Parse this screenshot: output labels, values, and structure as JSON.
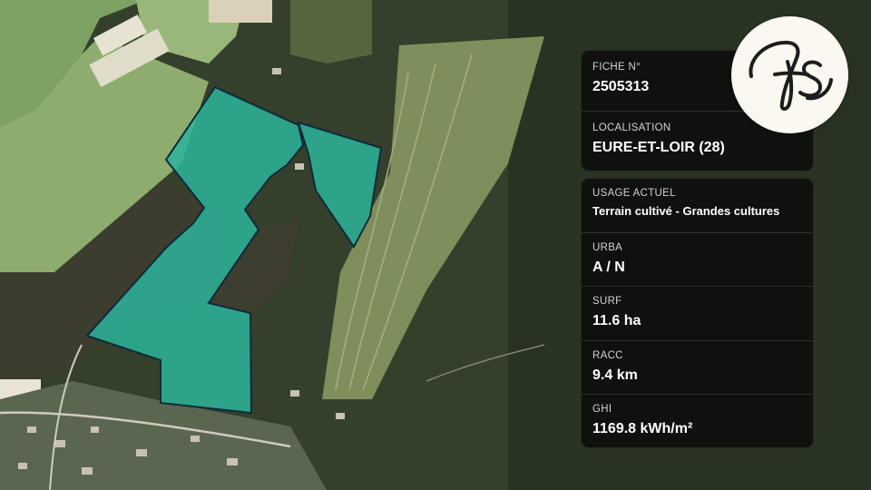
{
  "fiche": {
    "label": "FICHE N°",
    "value": "2505313"
  },
  "localisation": {
    "label": "LOCALISATION",
    "value": "EURE-ET-LOIR (28)"
  },
  "usage": {
    "label": "USAGE ACTUEL",
    "value": "Terrain cultivé - Grandes cultures"
  },
  "urba": {
    "label": "URBA",
    "value": "A / N"
  },
  "surf": {
    "label": "SURF",
    "value": "11.6 ha"
  },
  "racc": {
    "label": "RACC",
    "value": "9.4 km"
  },
  "ghi": {
    "label": "GHI",
    "value": "1169.8 kWh/m²"
  },
  "logo": {
    "icon": "fs-monogram-logo",
    "text": "fs"
  },
  "colors": {
    "parcel_fill": "#2cb39a",
    "parcel_stroke": "#0e2a3a",
    "card_bg": "#0c0c0c",
    "logo_bg": "#fbf8f1"
  }
}
